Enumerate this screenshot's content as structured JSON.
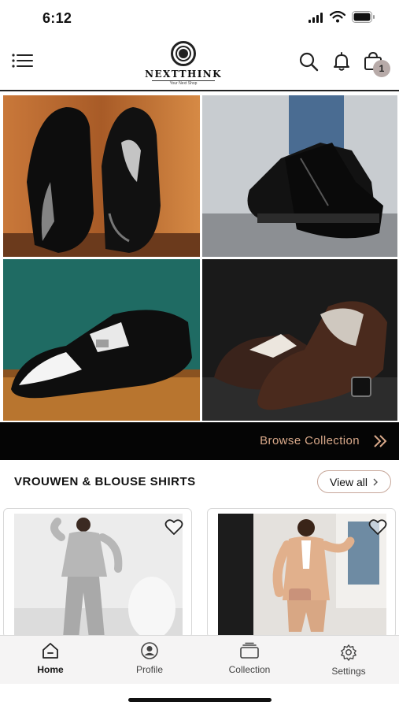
{
  "status_bar": {
    "time": "6:12"
  },
  "header": {
    "brand_name": "NEXTTHINK",
    "brand_tagline": "Your Next Shop",
    "cart_count": "1"
  },
  "banner": {
    "browse_label": "Browse Collection"
  },
  "section": {
    "title": "VROUWEN & BLOUSE SHIRTS",
    "view_all_label": "View all"
  },
  "tabs": [
    {
      "label": "Home",
      "icon": "home-icon",
      "active": true
    },
    {
      "label": "Profile",
      "icon": "user-icon",
      "active": false
    },
    {
      "label": "Collection",
      "icon": "collection-icon",
      "active": false
    },
    {
      "label": "Settings",
      "icon": "gear-icon",
      "active": false
    }
  ],
  "colors": {
    "accent": "#d9a98a",
    "badge": "#b7aaa8",
    "banner_bg": "#050505"
  }
}
